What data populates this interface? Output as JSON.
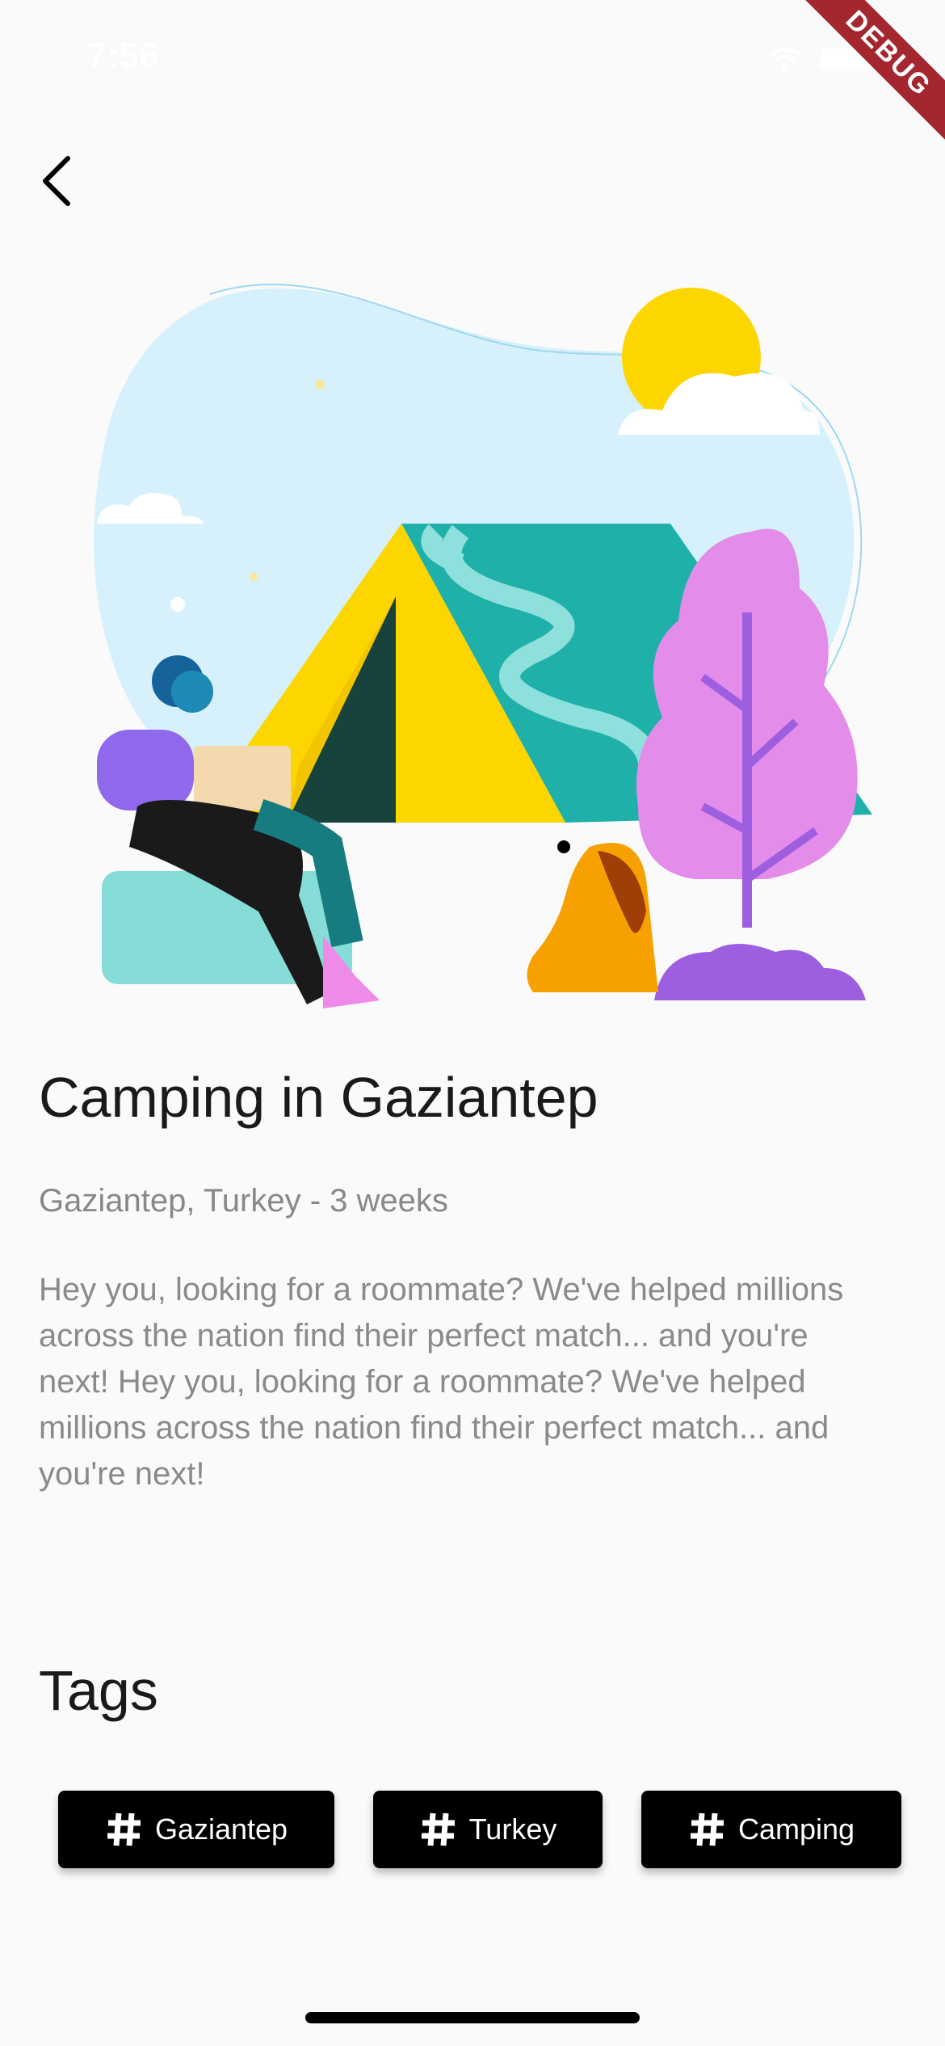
{
  "status_bar": {
    "time": "7:56",
    "icons": [
      "wifi-icon",
      "battery-icon"
    ]
  },
  "debug_banner": {
    "label": "DEBUG",
    "color": "#a4262f"
  },
  "header": {
    "back_icon": "chevron-left-icon"
  },
  "trip": {
    "title": "Camping in Gaziantep",
    "subtitle": "Gaziantep, Turkey - 3 weeks",
    "description": "Hey you, looking for a roommate? We've helped millions across the nation find their perfect match... and you're next! Hey you, looking for a roommate? We've helped millions across the nation find their perfect match... and you're next!"
  },
  "tags": {
    "heading": "Tags",
    "items": [
      {
        "label": "Gaziantep",
        "icon": "hashtag-icon"
      },
      {
        "label": "Turkey",
        "icon": "hashtag-icon"
      },
      {
        "label": "Camping",
        "icon": "hashtag-icon"
      }
    ]
  },
  "colors": {
    "background": "#fafafa",
    "tag_background": "#000000",
    "tag_text": "#ffffff",
    "title_text": "#1a1a1a",
    "secondary_text": "#888888"
  }
}
